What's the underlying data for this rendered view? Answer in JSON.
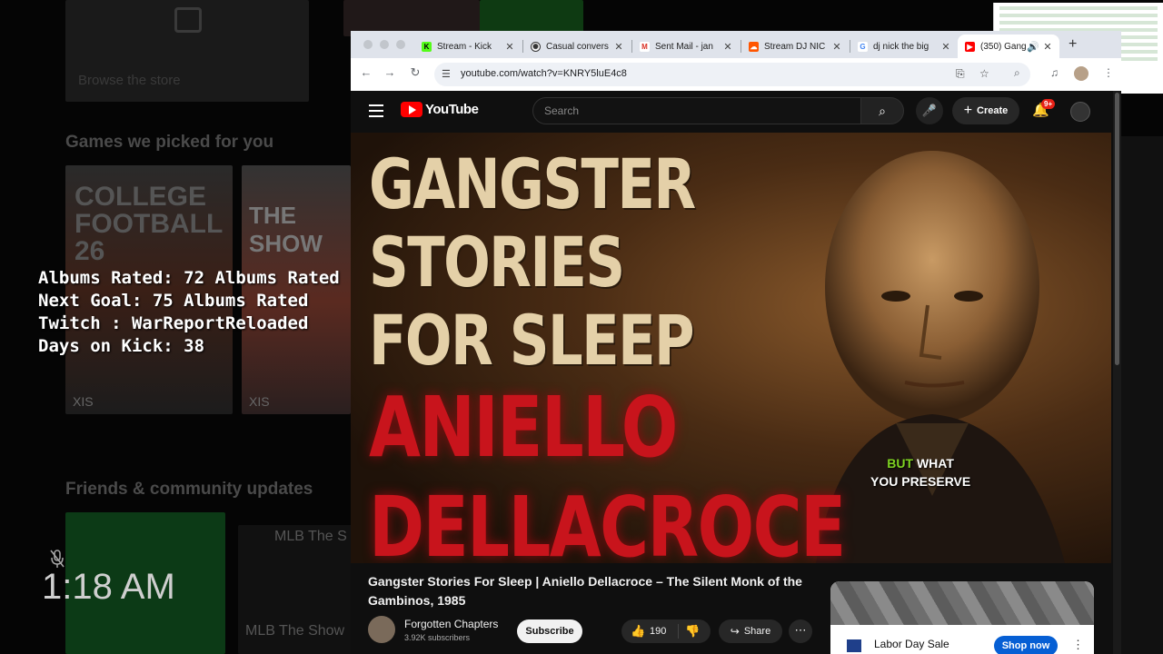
{
  "dashboard": {
    "store_label": "Browse the store",
    "games_heading": "Games we picked for you",
    "game1_title_line1": "COLLEGE",
    "game1_title_line2": "FOOTBALL",
    "game1_number": "26",
    "game1_tag": "XIS",
    "game2_title": "THE SHOW",
    "game2_tag": "XIS",
    "friends_heading": "Friends & community updates",
    "mlb_label_1": "MLB The S",
    "mlb_label_2": "MLB The Show",
    "clock": "1:18 AM"
  },
  "overlay": {
    "line1": "Albums Rated: 72 Albums Rated",
    "line2": "Next Goal: 75 Albums Rated",
    "line3": "Twitch : WarReportReloaded",
    "line4": "Days on Kick: 38"
  },
  "browser": {
    "tabs": [
      {
        "label": "Stream - Kick",
        "favicon": "kick-icon",
        "color": "#53fc18"
      },
      {
        "label": "Casual convers",
        "favicon": "chatgpt-icon",
        "color": "#333333"
      },
      {
        "label": "Sent Mail - jan",
        "favicon": "gmail-icon",
        "color": "#d93025"
      },
      {
        "label": "Stream DJ NIC",
        "favicon": "soundcloud-icon",
        "color": "#ff5500"
      },
      {
        "label": "dj nick the big",
        "favicon": "google-icon",
        "color": "#4285f4"
      },
      {
        "label": "(350) Gang",
        "favicon": "youtube-icon",
        "color": "#ff0000"
      }
    ],
    "url": "youtube.com/watch?v=KNRY5luE4c8"
  },
  "youtube": {
    "logo_text": "YouTube",
    "search_placeholder": "Search",
    "create_label": "Create",
    "notification_badge": "9+",
    "thumbnail_lines": [
      "GANGSTER",
      "STORIES",
      "FOR SLEEP"
    ],
    "thumbnail_red_lines": [
      "ANIELLO",
      "DELLACROCE"
    ],
    "caption_highlight": "BUT",
    "caption_rest": " WHAT",
    "caption_line2": "YOU PRESERVE",
    "video_title": "Gangster Stories For Sleep | Aniello Dellacroce – The Silent Monk of the Gambinos, 1985",
    "channel_name": "Forgotten Chapters",
    "subscriber_count": "3.92K subscribers",
    "subscribe_label": "Subscribe",
    "like_count": "190",
    "share_label": "Share",
    "ad": {
      "title": "Labor Day Sale",
      "cta": "Shop now"
    }
  }
}
